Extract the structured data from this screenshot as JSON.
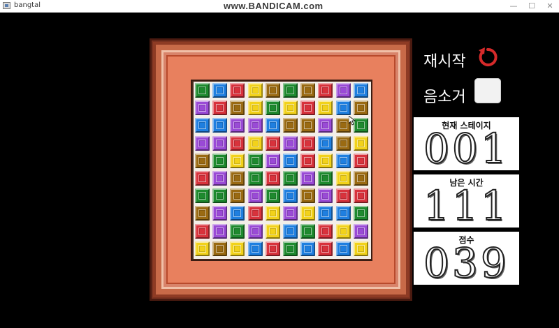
{
  "window": {
    "title": "bangtal",
    "watermark": "www.BANDICAM.com",
    "minimize": "—",
    "maximize": "☐",
    "close": "✕"
  },
  "controls": {
    "restart_label": "재시작",
    "mute_label": "음소거"
  },
  "stats": {
    "stage_title": "현재 스테이지",
    "stage_value": "001",
    "time_title": "남은 시간",
    "time_value": "111",
    "score_title": "점수",
    "score_value": "039"
  },
  "colors": {
    "G": "#1e8a2e",
    "B": "#1f7fe0",
    "R": "#d8323c",
    "Y": "#f2d21a",
    "N": "#9a6a12",
    "P": "#9a4ad6"
  },
  "board": [
    [
      "G",
      "B",
      "R",
      "Y",
      "N",
      "G",
      "N",
      "R",
      "P",
      "B"
    ],
    [
      "P",
      "R",
      "N",
      "Y",
      "G",
      "Y",
      "R",
      "Y",
      "B",
      "N"
    ],
    [
      "B",
      "B",
      "P",
      "P",
      "B",
      "N",
      "N",
      "P",
      "N",
      "G"
    ],
    [
      "P",
      "P",
      "R",
      "Y",
      "R",
      "P",
      "R",
      "B",
      "N",
      "Y"
    ],
    [
      "N",
      "G",
      "Y",
      "G",
      "P",
      "B",
      "R",
      "Y",
      "B",
      "R"
    ],
    [
      "R",
      "P",
      "N",
      "G",
      "R",
      "G",
      "P",
      "G",
      "Y",
      "N"
    ],
    [
      "G",
      "G",
      "N",
      "P",
      "G",
      "B",
      "N",
      "P",
      "R",
      "R"
    ],
    [
      "N",
      "P",
      "B",
      "R",
      "Y",
      "P",
      "Y",
      "B",
      "B",
      "G"
    ],
    [
      "R",
      "P",
      "G",
      "P",
      "Y",
      "B",
      "G",
      "R",
      "Y",
      "P"
    ],
    [
      "Y",
      "N",
      "Y",
      "B",
      "R",
      "G",
      "B",
      "R",
      "B",
      "Y"
    ]
  ]
}
